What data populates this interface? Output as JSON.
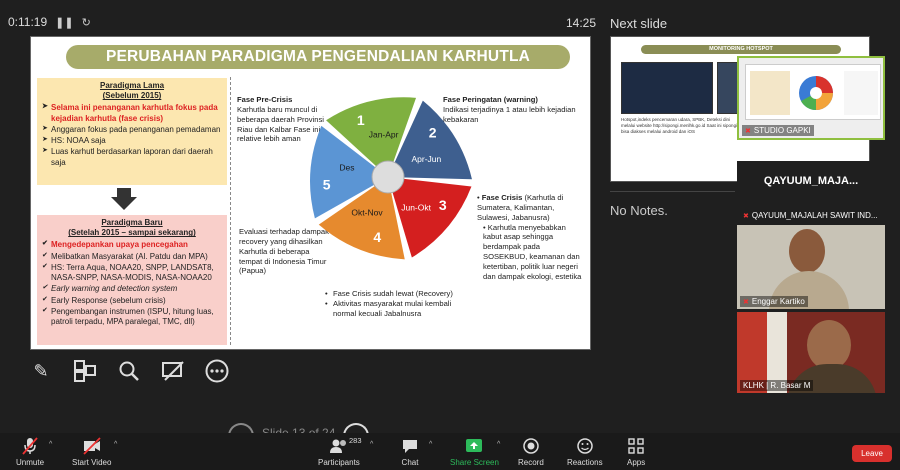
{
  "top": {
    "timer": "0:11:19",
    "clock": "14:25",
    "next_label": "Next slide"
  },
  "slide": {
    "title": "PERUBAHAN PARADIGMA PENGENDALIAN KARHUTLA",
    "old": {
      "title": "Paradigma Lama",
      "subtitle": "(Sebelum 2015)",
      "items": [
        "Selama ini penanganan karhutla fokus pada kejadian karhutla (fase crisis)",
        "Anggaran fokus pada penanganan pemadaman",
        "HS: NOAA saja",
        "Luas karhutl berdasarkan laporan dari daerah saja"
      ]
    },
    "new": {
      "title": "Paradigma Baru",
      "subtitle": "(Setelah 2015 – sampai sekarang)",
      "items": [
        "Mengedepankan upaya pencegahan",
        "Melibatkan Masyarakat (Al. Patdu dan MPA)",
        "HS: Terra Aqua, NOAA20, SNPP, LANDSAT8, NASA-SNPP, NASA-MODIS, NASA-NOAA20",
        "Early warning and detection system",
        "Early Response (sebelum crisis)",
        "Pengembangan instrumen (ISPU, hitung luas, patroli terpadu, MPA paralegal, TMC, dll)"
      ]
    },
    "pre_crisis": {
      "title": "Fase Pre-Crisis",
      "body": "Karhutla baru muncul di beberapa daerah Provinsi Riau dan Kalbar Fase ini relative lebih aman"
    },
    "warning": {
      "title": "Fase Peringatan (warning)",
      "body": "Indikasi terjadinya 1 atau lebih kejadian kebakaran"
    },
    "crisis": {
      "title": "Fase Crisis",
      "title_suffix": "(Karhutla di Sumatera, Kalimantan, Sulawesi, Jabanusra)",
      "body": "Karhutla menyebabkan kabut asap sehingga berdampak pada SOSEKBUD, keamanan dan ketertiban, politik luar negeri dan dampak ekologi, estetika"
    },
    "recovery_eval": {
      "body": "Evaluasi terhadap dampak recovery yang dihasilkan Karhutla di beberapa tempat di Indonesia Timur (Papua)"
    },
    "bottom_bullets": [
      "Fase Crisis sudah lewat (Recovery)",
      "Aktivitas masyarakat mulai kembali normal kecuali Jabalnusra"
    ],
    "wheel": [
      {
        "num": "1",
        "label": "Jan-Apr",
        "color": "#7fb040"
      },
      {
        "num": "2",
        "label": "Apr-Jun",
        "color": "#3e5f8f"
      },
      {
        "num": "3",
        "label": "Jun-Okt",
        "color": "#d41f1f"
      },
      {
        "num": "4",
        "label": "Okt-Nov",
        "color": "#e68a2e"
      },
      {
        "num": "5",
        "label": "Des",
        "color": "#5b95d4"
      }
    ]
  },
  "next_slide": {
    "title": "MONITORING HOTSPOT",
    "text": "Hotspot,indeks pencemaran udara, SPBK, Deteksi dini melalui website http://sipongi.menlhk.go.id Saat ini sipongi bisa diakses melalui android dan iOS"
  },
  "notes": "No Notes.",
  "videos": [
    {
      "name": "STUDIO GAPKI"
    },
    {
      "big": "QAYUUM_MAJA...",
      "name": "QAYUUM_MAJALAH SAWIT IND..."
    },
    {
      "name": "Enggar Kartiko"
    },
    {
      "name": "KLHK | R. Basar M"
    }
  ],
  "pager": {
    "text": "Slide 13 of 24"
  },
  "toolbar": {
    "unmute": "Unmute",
    "start_video": "Start Video",
    "participants": "Participants",
    "participants_count": "283",
    "chat": "Chat",
    "share_screen": "Share Screen",
    "record": "Record",
    "reactions": "Reactions",
    "apps": "Apps",
    "leave": "Leave"
  }
}
